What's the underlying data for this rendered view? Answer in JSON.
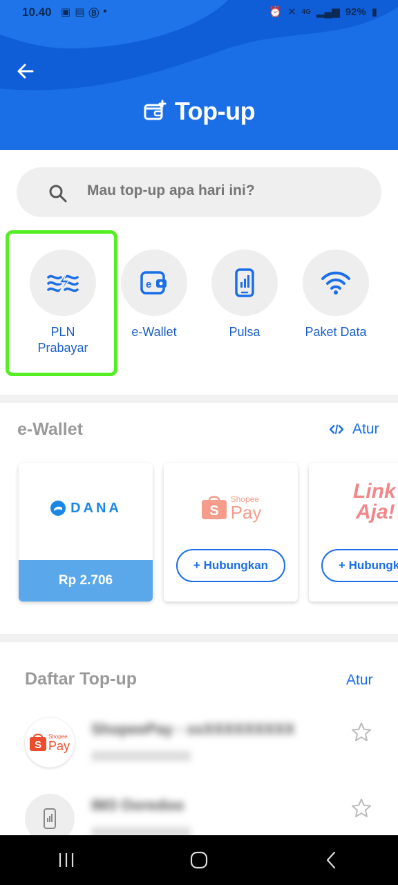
{
  "status_bar": {
    "time": "10.40",
    "battery": "92%",
    "network": "4G"
  },
  "header": {
    "title": "Top-up"
  },
  "search": {
    "placeholder": "Mau top-up apa hari ini?"
  },
  "categories": [
    {
      "label": "PLN\nPrabayar",
      "icon": "lightning-waves-icon",
      "selected": true
    },
    {
      "label": "e-Wallet",
      "icon": "wallet-icon",
      "selected": false
    },
    {
      "label": "Pulsa",
      "icon": "phone-icon",
      "selected": false
    },
    {
      "label": "Paket Data",
      "icon": "wifi-icon",
      "selected": false
    }
  ],
  "ewallet_section": {
    "title": "e-Wallet",
    "atur_label": "Atur",
    "cards": [
      {
        "name": "DANA",
        "balance": "Rp 2.706"
      },
      {
        "name": "ShopeePay",
        "logo_small": "Shopee",
        "logo_big": "Pay",
        "action": "+ Hubungkan"
      },
      {
        "name": "LinkAja",
        "logo_line1": "Link",
        "logo_line2": "Aja!",
        "action": "+ Hubungkan"
      }
    ]
  },
  "topup_list": {
    "title": "Daftar Top-up",
    "atur_label": "Atur",
    "items": [
      {
        "name": "ShopeePay - xxXXXXXXXXX",
        "sub": "XXXXXXXXXXXX",
        "avatar": "shopeepay-logo"
      },
      {
        "name": "IM3 Ooredoo",
        "sub": "XXXXXXXXXXXX",
        "avatar": "phone-icon"
      }
    ]
  },
  "colors": {
    "primary": "#1a6ee6",
    "highlight": "#55ee22",
    "dana_balance_bg": "#5aa8ea",
    "shopee": "#ee4d2d",
    "linkaja": "#e82529"
  }
}
